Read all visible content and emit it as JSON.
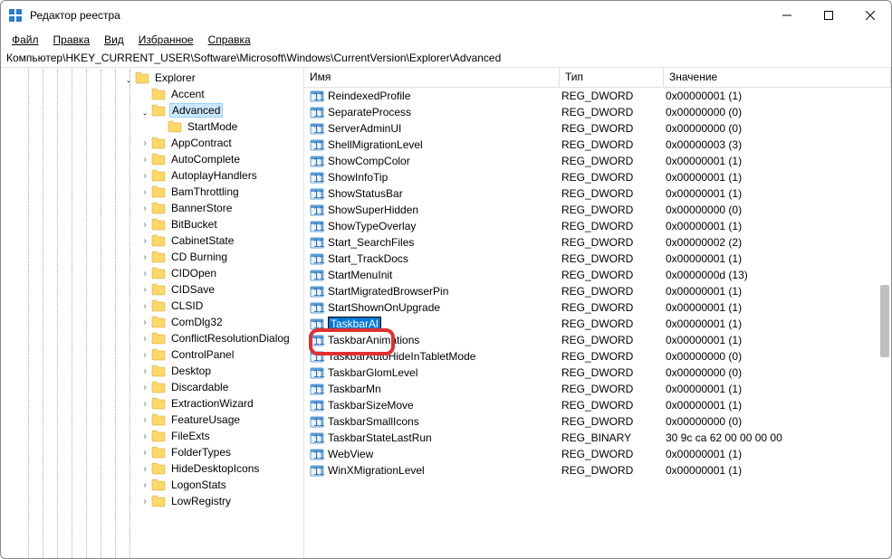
{
  "window": {
    "title": "Редактор реестра"
  },
  "menu": {
    "file": "Файл",
    "edit": "Правка",
    "view": "Вид",
    "favorites": "Избранное",
    "help": "Справка"
  },
  "path": "Компьютер\\HKEY_CURRENT_USER\\Software\\Microsoft\\Windows\\CurrentVersion\\Explorer\\Advanced",
  "tree": {
    "explorer": "Explorer",
    "items": [
      "Accent",
      "Advanced",
      "StartMode",
      "AppContract",
      "AutoComplete",
      "AutoplayHandlers",
      "BamThrottling",
      "BannerStore",
      "BitBucket",
      "CabinetState",
      "CD Burning",
      "CIDOpen",
      "CIDSave",
      "CLSID",
      "ComDlg32",
      "ConflictResolutionDialog",
      "ControlPanel",
      "Desktop",
      "Discardable",
      "ExtractionWizard",
      "FeatureUsage",
      "FileExts",
      "FolderTypes",
      "HideDesktopIcons",
      "LogonStats",
      "LowRegistry"
    ]
  },
  "columns": {
    "name": "Имя",
    "type": "Тип",
    "value": "Значение"
  },
  "values": [
    {
      "name": "ReindexedProfile",
      "type": "REG_DWORD",
      "value": "0x00000001 (1)"
    },
    {
      "name": "SeparateProcess",
      "type": "REG_DWORD",
      "value": "0x00000000 (0)"
    },
    {
      "name": "ServerAdminUI",
      "type": "REG_DWORD",
      "value": "0x00000000 (0)"
    },
    {
      "name": "ShellMigrationLevel",
      "type": "REG_DWORD",
      "value": "0x00000003 (3)"
    },
    {
      "name": "ShowCompColor",
      "type": "REG_DWORD",
      "value": "0x00000001 (1)"
    },
    {
      "name": "ShowInfoTip",
      "type": "REG_DWORD",
      "value": "0x00000001 (1)"
    },
    {
      "name": "ShowStatusBar",
      "type": "REG_DWORD",
      "value": "0x00000001 (1)"
    },
    {
      "name": "ShowSuperHidden",
      "type": "REG_DWORD",
      "value": "0x00000000 (0)"
    },
    {
      "name": "ShowTypeOverlay",
      "type": "REG_DWORD",
      "value": "0x00000001 (1)"
    },
    {
      "name": "Start_SearchFiles",
      "type": "REG_DWORD",
      "value": "0x00000002 (2)"
    },
    {
      "name": "Start_TrackDocs",
      "type": "REG_DWORD",
      "value": "0x00000001 (1)"
    },
    {
      "name": "StartMenuInit",
      "type": "REG_DWORD",
      "value": "0x0000000d (13)"
    },
    {
      "name": "StartMigratedBrowserPin",
      "type": "REG_DWORD",
      "value": "0x00000001 (1)"
    },
    {
      "name": "StartShownOnUpgrade",
      "type": "REG_DWORD",
      "value": "0x00000001 (1)"
    },
    {
      "name": "TaskbarAl",
      "type": "REG_DWORD",
      "value": "0x00000001 (1)",
      "selected": true
    },
    {
      "name": "TaskbarAnimations",
      "type": "REG_DWORD",
      "value": "0x00000001 (1)"
    },
    {
      "name": "TaskbarAutoHideInTabletMode",
      "type": "REG_DWORD",
      "value": "0x00000000 (0)"
    },
    {
      "name": "TaskbarGlomLevel",
      "type": "REG_DWORD",
      "value": "0x00000000 (0)"
    },
    {
      "name": "TaskbarMn",
      "type": "REG_DWORD",
      "value": "0x00000001 (1)"
    },
    {
      "name": "TaskbarSizeMove",
      "type": "REG_DWORD",
      "value": "0x00000001 (1)"
    },
    {
      "name": "TaskbarSmallIcons",
      "type": "REG_DWORD",
      "value": "0x00000000 (0)"
    },
    {
      "name": "TaskbarStateLastRun",
      "type": "REG_BINARY",
      "value": "30 9c ca 62 00 00 00 00"
    },
    {
      "name": "WebView",
      "type": "REG_DWORD",
      "value": "0x00000001 (1)"
    },
    {
      "name": "WinXMigrationLevel",
      "type": "REG_DWORD",
      "value": "0x00000001 (1)"
    }
  ]
}
